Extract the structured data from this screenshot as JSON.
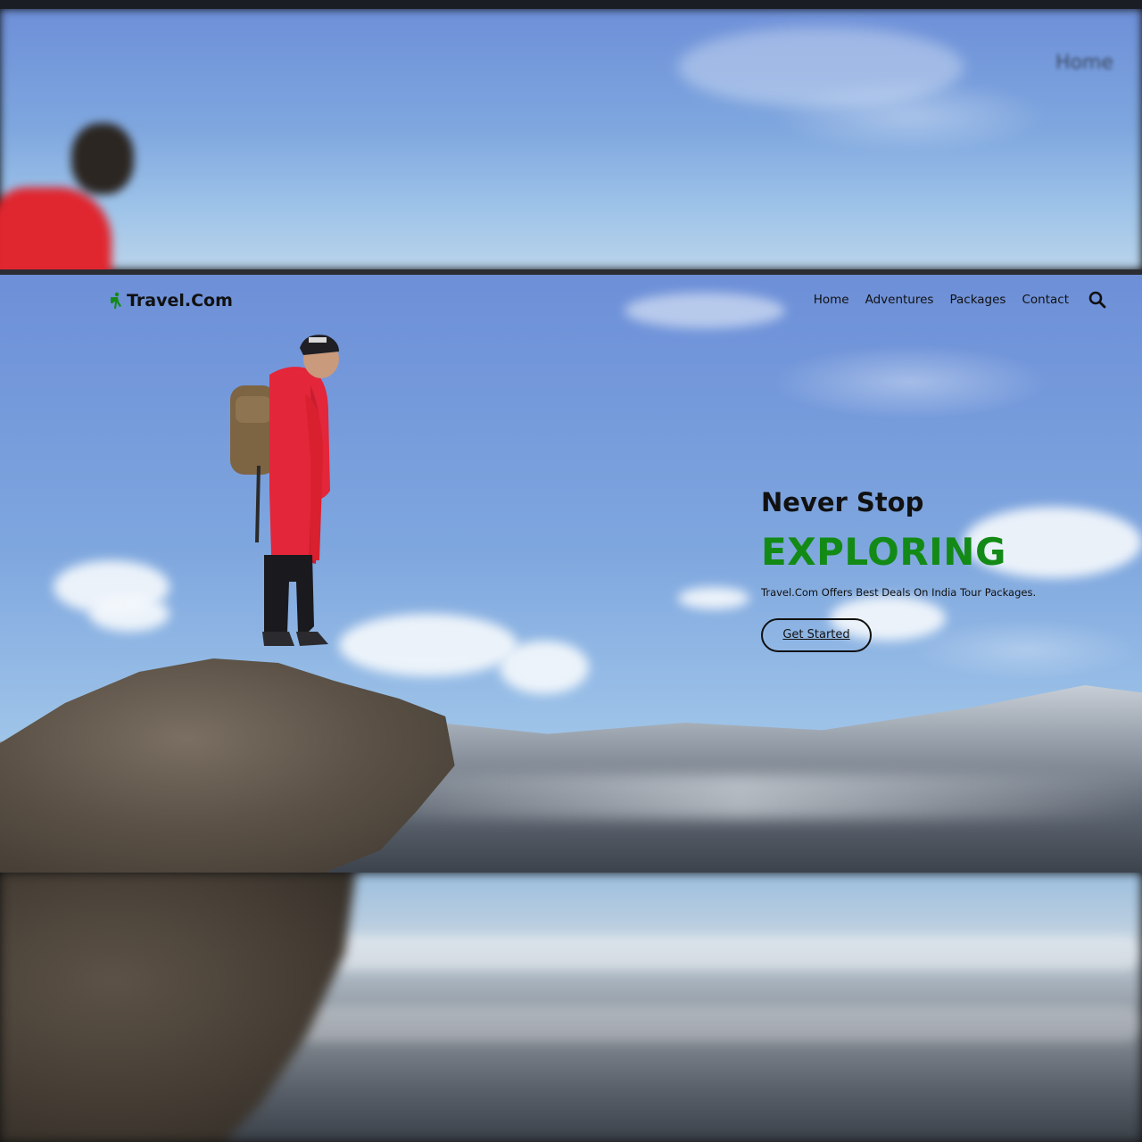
{
  "top_preview": {
    "nav_label": "Home"
  },
  "brand": {
    "name": "Travel.Com",
    "accent_color": "#138a16",
    "logo_icon": "hiker-icon"
  },
  "nav": {
    "items": [
      {
        "label": "Home"
      },
      {
        "label": "Adventures"
      },
      {
        "label": "Packages"
      },
      {
        "label": "Contact"
      }
    ],
    "search_icon": "search-icon"
  },
  "hero": {
    "headline_1": "Never Stop",
    "headline_2": "EXPLORING",
    "subtext": "Travel.Com Offers Best Deals On India Tour Packages.",
    "cta_label": "Get Started"
  }
}
